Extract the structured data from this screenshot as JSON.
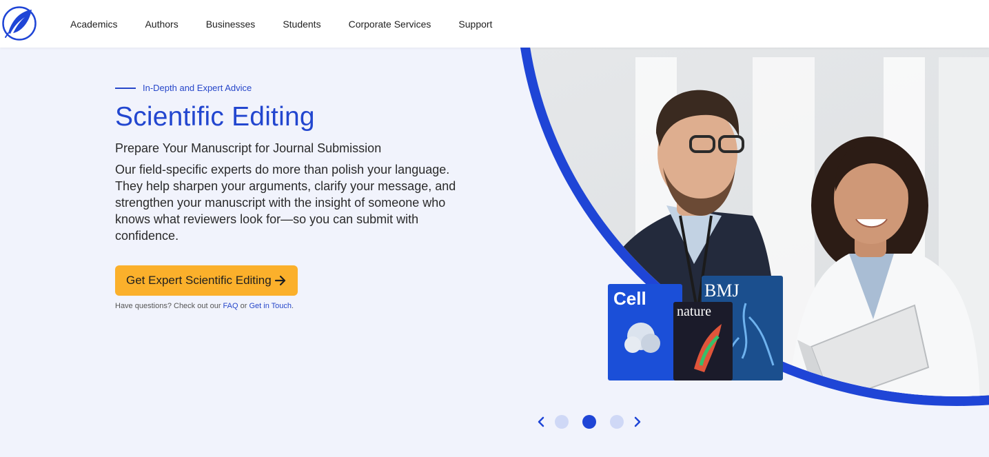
{
  "header": {
    "nav": [
      "Academics",
      "Authors",
      "Businesses",
      "Students",
      "Corporate Services",
      "Support"
    ]
  },
  "hero": {
    "eyebrow": "In-Depth and Expert Advice",
    "title": "Scientific Editing",
    "subtitle": "Prepare Your Manuscript for Journal Submission",
    "body": "Our field-specific experts do more than polish your language. They help sharpen your arguments, clarify your message, and strengthen your manuscript with the insight of someone who knows what reviewers look for—so you can submit with confidence.",
    "cta_label": "Get Expert Scientific Editing",
    "help_prefix": "Have questions? Check out our ",
    "help_faq": "FAQ",
    "help_or": " or ",
    "help_contact": "Get in Touch",
    "help_suffix": "."
  },
  "journals": {
    "cell": "Cell",
    "nature": "nature",
    "bmj": "BMJ"
  },
  "carousel": {
    "slide_count": 3,
    "active_index": 1
  },
  "colors": {
    "brand_blue": "#2246cf",
    "cta_orange": "#fbb02b",
    "background": "#f1f3fc"
  },
  "icons": [
    "quill-logo-icon",
    "arrow-right-icon",
    "chevron-left-icon",
    "chevron-right-icon"
  ]
}
